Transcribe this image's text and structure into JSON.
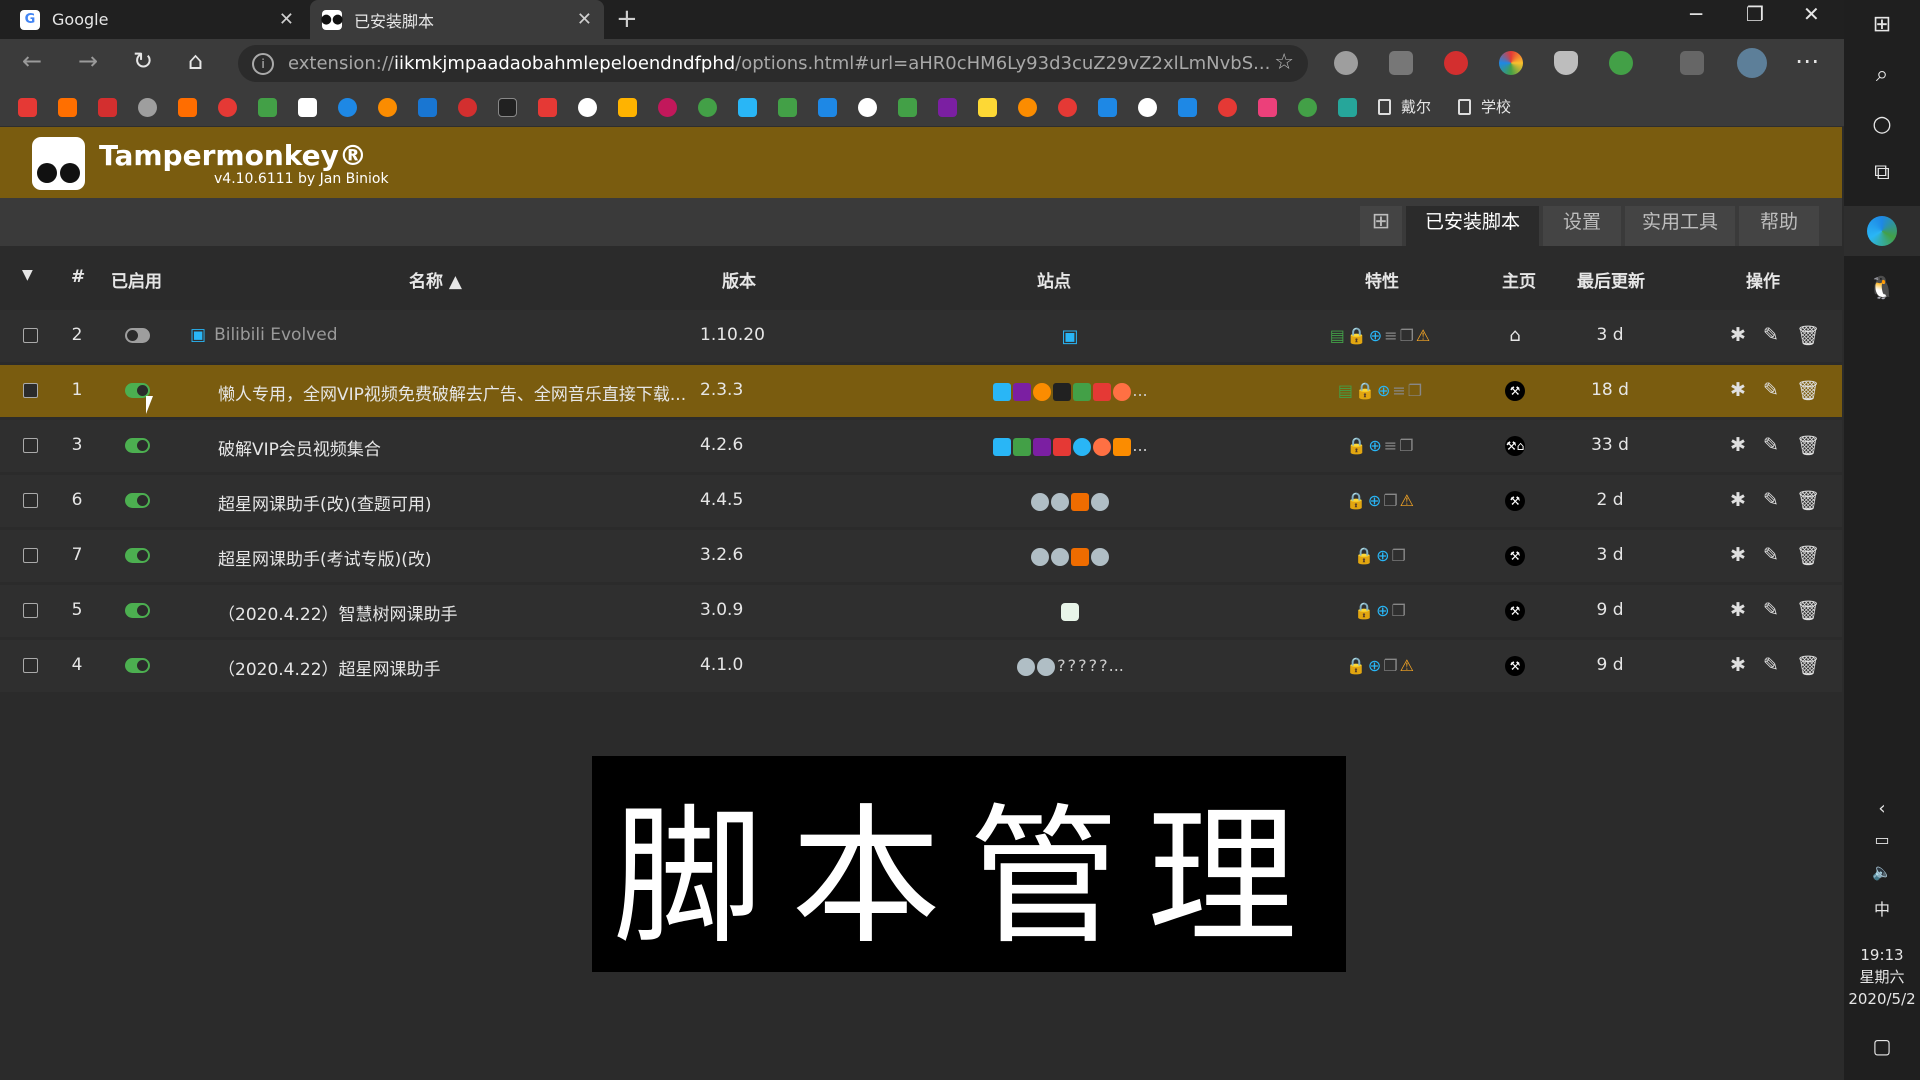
{
  "browser": {
    "tabs": [
      {
        "title": "Google",
        "favicon": "google-icon"
      },
      {
        "title": "已安装脚本",
        "favicon": "tampermonkey-icon"
      }
    ],
    "address": {
      "scheme": "extension://",
      "host": "iikmkjmpaadaobahmlepeloendndfphd",
      "path": "/options.html#url=aHR0cHM6Ly93d3cuZ29vZ2xlLmNvbS..."
    },
    "bookmark_folders": [
      "戴尔",
      "学校"
    ]
  },
  "tampermonkey": {
    "title": "Tampermonkey®",
    "version_line": "v4.10.6111 by Jan Biniok",
    "nav": {
      "add": "⊞",
      "installed": "已安装脚本",
      "settings": "设置",
      "utilities": "实用工具",
      "help": "帮助"
    }
  },
  "table": {
    "headers": {
      "filter": "▼",
      "num": "#",
      "enabled": "已启用",
      "name": "名称 ▲",
      "version": "版本",
      "sites": "站点",
      "features": "特性",
      "homepage": "主页",
      "updated": "最后更新",
      "actions": "操作"
    },
    "rows": [
      {
        "num": "2",
        "enabled": false,
        "name": "Bilibili Evolved",
        "version": "1.10.20",
        "updated": "3 d",
        "sites_more": "",
        "home": "⌂"
      },
      {
        "num": "1",
        "enabled": true,
        "name": "懒人专用，全网VIP视频免费破解去广告、全网音乐直接下载...",
        "version": "2.3.3",
        "updated": "18 d",
        "sites_more": "...",
        "home": "⚒"
      },
      {
        "num": "3",
        "enabled": true,
        "name": "破解VIP会员视频集合",
        "version": "4.2.6",
        "updated": "33 d",
        "sites_more": "...",
        "home": "⚒⌂"
      },
      {
        "num": "6",
        "enabled": true,
        "name": "超星网课助手(改)(查题可用)",
        "version": "4.4.5",
        "updated": "2 d",
        "sites_more": "",
        "home": "⚒"
      },
      {
        "num": "7",
        "enabled": true,
        "name": "超星网课助手(考试专版)(改)",
        "version": "3.2.6",
        "updated": "3 d",
        "sites_more": "",
        "home": "⚒"
      },
      {
        "num": "5",
        "enabled": true,
        "name": "（2020.4.22）智慧树网课助手",
        "version": "3.0.9",
        "updated": "9 d",
        "sites_more": "",
        "home": "⚒"
      },
      {
        "num": "4",
        "enabled": true,
        "name": "（2020.4.22）超星网课助手",
        "version": "4.1.0",
        "updated": "9 d",
        "sites_more": "...",
        "home": "⚒"
      }
    ]
  },
  "banner": {
    "text": "脚本管理"
  },
  "taskbar": {
    "ime": "中",
    "time": "19:13",
    "weekday": "星期六",
    "date": "2020/5/2"
  }
}
